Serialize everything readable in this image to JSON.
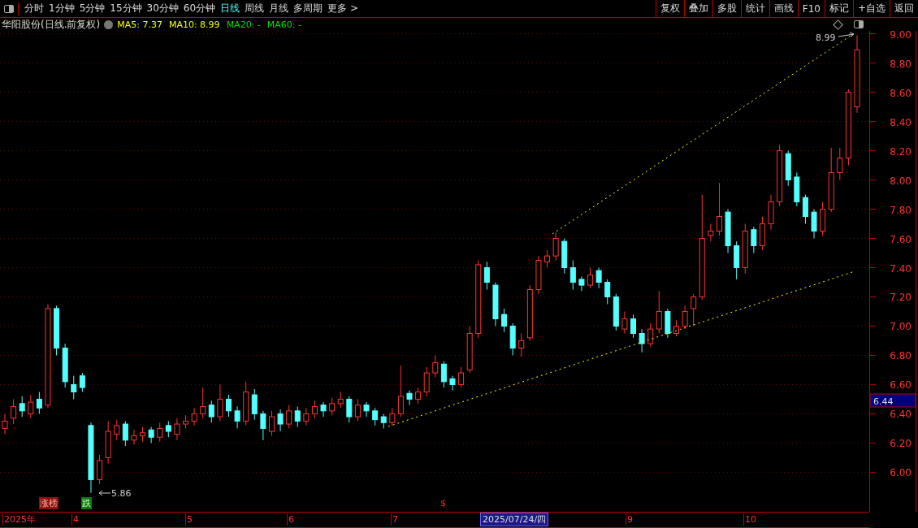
{
  "toolbar": {
    "periods": [
      {
        "label": "分时",
        "selected": false
      },
      {
        "label": "1分钟",
        "selected": false
      },
      {
        "label": "5分钟",
        "selected": false
      },
      {
        "label": "15分钟",
        "selected": false
      },
      {
        "label": "30分钟",
        "selected": false
      },
      {
        "label": "60分钟",
        "selected": false
      },
      {
        "label": "日线",
        "selected": true
      },
      {
        "label": "周线",
        "selected": false
      },
      {
        "label": "月线",
        "selected": false
      },
      {
        "label": "多周期",
        "selected": false
      },
      {
        "label": "更多 >",
        "selected": false
      }
    ],
    "buttons": [
      "复权",
      "叠加",
      "多股",
      "统计",
      "画线",
      "F10",
      "标记",
      "+自选",
      "返回"
    ]
  },
  "info": {
    "title": "华阳股份(日线.前复权)",
    "indicators": [
      {
        "label": "MA5: 7.37",
        "color": "#ffff00"
      },
      {
        "label": "MA10: 8.99",
        "color": "#ffff00"
      },
      {
        "label": "MA20: -",
        "color": "#00e000"
      },
      {
        "label": "MA60: -",
        "color": "#00e000"
      }
    ]
  },
  "chart_data": {
    "type": "candlestick",
    "ylim": [
      5.73,
      9.02
    ],
    "grid": true,
    "yticks": [
      {
        "value": 9.0,
        "label": "9.00"
      },
      {
        "value": 8.8,
        "label": "8.80"
      },
      {
        "value": 8.6,
        "label": "8.60"
      },
      {
        "value": 8.4,
        "label": "8.40"
      },
      {
        "value": 8.2,
        "label": "8.20"
      },
      {
        "value": 8.0,
        "label": "8.00"
      },
      {
        "value": 7.8,
        "label": "7.80"
      },
      {
        "value": 7.6,
        "label": "7.60"
      },
      {
        "value": 7.4,
        "label": "7.40"
      },
      {
        "value": 7.2,
        "label": "7.20"
      },
      {
        "value": 7.0,
        "label": "7.00"
      },
      {
        "value": 6.8,
        "label": "6.80"
      },
      {
        "value": 6.6,
        "label": "6.60"
      },
      {
        "value": 6.4,
        "label": "6.40"
      },
      {
        "value": 6.2,
        "label": "6.20"
      },
      {
        "value": 6.0,
        "label": "6.00"
      }
    ],
    "ohlc": [
      [
        6.3,
        6.4,
        6.26,
        6.35
      ],
      [
        6.37,
        6.5,
        6.33,
        6.45
      ],
      [
        6.47,
        6.52,
        6.38,
        6.42
      ],
      [
        6.4,
        6.53,
        6.37,
        6.48
      ],
      [
        6.5,
        6.55,
        6.4,
        6.44
      ],
      [
        6.46,
        7.15,
        6.44,
        7.12
      ],
      [
        7.12,
        7.14,
        6.8,
        6.85
      ],
      [
        6.85,
        6.88,
        6.58,
        6.62
      ],
      [
        6.6,
        6.66,
        6.5,
        6.55
      ],
      [
        6.66,
        6.68,
        6.55,
        6.58
      ],
      [
        6.32,
        6.34,
        5.86,
        5.95
      ],
      [
        5.95,
        6.12,
        5.92,
        6.08
      ],
      [
        6.1,
        6.35,
        6.06,
        6.28
      ],
      [
        6.26,
        6.36,
        6.22,
        6.32
      ],
      [
        6.33,
        6.35,
        6.18,
        6.22
      ],
      [
        6.22,
        6.29,
        6.19,
        6.25
      ],
      [
        6.25,
        6.31,
        6.21,
        6.27
      ],
      [
        6.29,
        6.31,
        6.2,
        6.24
      ],
      [
        6.24,
        6.34,
        6.21,
        6.3
      ],
      [
        6.32,
        6.35,
        6.24,
        6.28
      ],
      [
        6.26,
        6.37,
        6.22,
        6.33
      ],
      [
        6.33,
        6.39,
        6.3,
        6.35
      ],
      [
        6.35,
        6.44,
        6.32,
        6.4
      ],
      [
        6.4,
        6.58,
        6.37,
        6.45
      ],
      [
        6.46,
        6.49,
        6.34,
        6.38
      ],
      [
        6.38,
        6.6,
        6.35,
        6.5
      ],
      [
        6.5,
        6.53,
        6.38,
        6.42
      ],
      [
        6.42,
        6.45,
        6.3,
        6.35
      ],
      [
        6.35,
        6.62,
        6.32,
        6.55
      ],
      [
        6.53,
        6.57,
        6.36,
        6.4
      ],
      [
        6.4,
        6.42,
        6.22,
        6.3
      ],
      [
        6.28,
        6.42,
        6.25,
        6.38
      ],
      [
        6.4,
        6.43,
        6.28,
        6.33
      ],
      [
        6.33,
        6.46,
        6.3,
        6.42
      ],
      [
        6.42,
        6.45,
        6.31,
        6.35
      ],
      [
        6.35,
        6.44,
        6.32,
        6.4
      ],
      [
        6.4,
        6.49,
        6.37,
        6.45
      ],
      [
        6.46,
        6.48,
        6.38,
        6.42
      ],
      [
        6.42,
        6.51,
        6.39,
        6.47
      ],
      [
        6.47,
        6.55,
        6.44,
        6.5
      ],
      [
        6.5,
        6.52,
        6.34,
        6.38
      ],
      [
        6.38,
        6.5,
        6.35,
        6.46
      ],
      [
        6.46,
        6.48,
        6.38,
        6.42
      ],
      [
        6.42,
        6.44,
        6.32,
        6.36
      ],
      [
        6.38,
        6.4,
        6.3,
        6.34
      ],
      [
        6.34,
        6.44,
        6.32,
        6.4
      ],
      [
        6.4,
        6.73,
        6.38,
        6.52
      ],
      [
        6.54,
        6.56,
        6.46,
        6.5
      ],
      [
        6.5,
        6.58,
        6.47,
        6.55
      ],
      [
        6.55,
        6.72,
        6.52,
        6.68
      ],
      [
        6.68,
        6.8,
        6.65,
        6.75
      ],
      [
        6.74,
        6.76,
        6.58,
        6.62
      ],
      [
        6.64,
        6.66,
        6.56,
        6.6
      ],
      [
        6.6,
        6.72,
        6.58,
        6.68
      ],
      [
        6.7,
        7.0,
        6.68,
        6.95
      ],
      [
        6.95,
        7.45,
        6.92,
        7.42
      ],
      [
        7.4,
        7.44,
        7.25,
        7.3
      ],
      [
        7.28,
        7.3,
        7.0,
        7.05
      ],
      [
        7.08,
        7.12,
        6.96,
        7.0
      ],
      [
        7.0,
        7.02,
        6.8,
        6.85
      ],
      [
        6.85,
        6.95,
        6.79,
        6.9
      ],
      [
        6.92,
        7.28,
        6.9,
        7.25
      ],
      [
        7.25,
        7.48,
        7.22,
        7.45
      ],
      [
        7.44,
        7.52,
        7.4,
        7.48
      ],
      [
        7.48,
        7.64,
        7.45,
        7.6
      ],
      [
        7.58,
        7.6,
        7.36,
        7.4
      ],
      [
        7.4,
        7.45,
        7.25,
        7.3
      ],
      [
        7.32,
        7.34,
        7.24,
        7.28
      ],
      [
        7.28,
        7.4,
        7.26,
        7.35
      ],
      [
        7.38,
        7.4,
        7.26,
        7.3
      ],
      [
        7.3,
        7.32,
        7.15,
        7.2
      ],
      [
        7.2,
        7.22,
        6.97,
        7.0
      ],
      [
        6.98,
        7.1,
        6.95,
        7.05
      ],
      [
        7.05,
        7.08,
        6.92,
        6.95
      ],
      [
        6.95,
        6.98,
        6.82,
        6.88
      ],
      [
        6.88,
        7.02,
        6.86,
        6.98
      ],
      [
        6.98,
        7.24,
        6.95,
        7.1
      ],
      [
        7.1,
        7.12,
        6.92,
        6.95
      ],
      [
        6.95,
        7.04,
        6.93,
        7.0
      ],
      [
        7.0,
        7.14,
        6.98,
        7.1
      ],
      [
        7.12,
        7.22,
        7.0,
        7.2
      ],
      [
        7.2,
        7.9,
        7.18,
        7.6
      ],
      [
        7.62,
        7.7,
        7.58,
        7.65
      ],
      [
        7.65,
        7.98,
        7.62,
        7.75
      ],
      [
        7.78,
        7.8,
        7.5,
        7.55
      ],
      [
        7.55,
        7.58,
        7.32,
        7.4
      ],
      [
        7.4,
        7.7,
        7.36,
        7.65
      ],
      [
        7.66,
        7.68,
        7.5,
        7.55
      ],
      [
        7.55,
        7.75,
        7.52,
        7.7
      ],
      [
        7.7,
        7.9,
        7.66,
        7.85
      ],
      [
        7.85,
        8.24,
        7.82,
        8.2
      ],
      [
        8.18,
        8.2,
        7.96,
        8.0
      ],
      [
        8.02,
        8.05,
        7.82,
        7.85
      ],
      [
        7.88,
        7.9,
        7.7,
        7.75
      ],
      [
        7.78,
        7.8,
        7.6,
        7.65
      ],
      [
        7.65,
        7.85,
        7.62,
        7.8
      ],
      [
        7.8,
        8.22,
        7.78,
        8.05
      ],
      [
        8.05,
        8.22,
        8.0,
        8.15
      ],
      [
        8.15,
        8.62,
        8.1,
        8.6
      ],
      [
        8.5,
        8.99,
        8.46,
        8.89
      ]
    ],
    "annotations": [
      "8.99",
      "5.86"
    ]
  },
  "current_price": "6.44",
  "markers": [
    {
      "label": "涨榜",
      "kind": "up"
    },
    {
      "label": "跌",
      "kind": "down"
    },
    {
      "label": "$",
      "kind": "signal"
    }
  ],
  "time_axis": [
    {
      "label": "2025年",
      "kind": "tick"
    },
    {
      "label": "4",
      "kind": "tick"
    },
    {
      "label": "5",
      "kind": "tick"
    },
    {
      "label": "6",
      "kind": "tick"
    },
    {
      "label": "7",
      "kind": "tick"
    },
    {
      "label": "2025/07/24/四",
      "kind": "cursor"
    },
    {
      "label": "9",
      "kind": "tick"
    },
    {
      "label": "10",
      "kind": "tick"
    }
  ]
}
